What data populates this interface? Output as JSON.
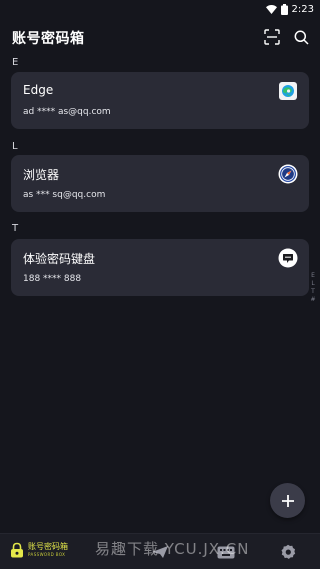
{
  "status": {
    "time": "2:23"
  },
  "header": {
    "title": "账号密码箱"
  },
  "sections": [
    {
      "letter": "E",
      "title": "Edge",
      "subtitle": "ad **** as@qq.com",
      "icon": "edge-icon"
    },
    {
      "letter": "L",
      "title": "浏览器",
      "subtitle": "as *** sq@qq.com",
      "icon": "compass-icon"
    },
    {
      "letter": "T",
      "title": "体验密码键盘",
      "subtitle": "188 **** 888",
      "icon": "chat-icon"
    }
  ],
  "index_letters": [
    "E",
    "L",
    "T",
    "#"
  ],
  "bottom_nav": {
    "brand_main": "账号密码箱",
    "brand_sub": "PASSWORD BOX"
  },
  "watermark": "易趣下载 YCU.JX.CN",
  "colors": {
    "background": "#15161d",
    "card": "#2a2b36",
    "brand": "#e4e84a"
  }
}
